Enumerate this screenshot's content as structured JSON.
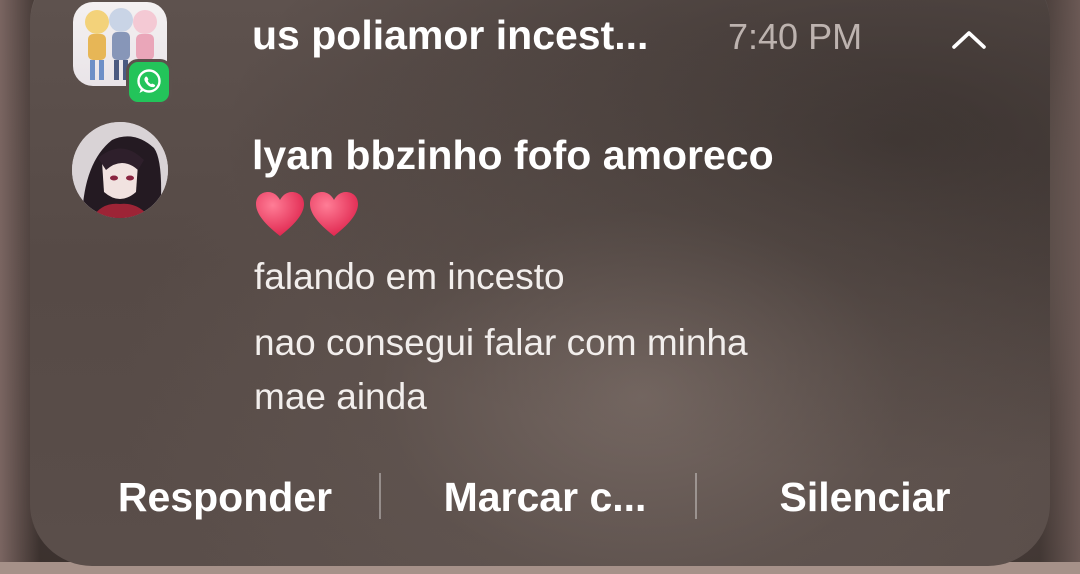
{
  "notification": {
    "app_icon": "whatsapp-icon",
    "group_title": "us poliamor incest...",
    "time": "7:40 PM",
    "collapse_icon": "chevron-up-icon",
    "sender_name": "lyan bbzinho fofo amoreco",
    "messages": [
      {
        "text": "❤️❤️",
        "kind": "emoji"
      },
      {
        "text": "falando em incesto",
        "kind": "text"
      },
      {
        "text": "nao consegui falar com minha",
        "kind": "text"
      },
      {
        "text": "mae ainda",
        "kind": "text"
      }
    ],
    "actions": [
      {
        "label": "Responder"
      },
      {
        "label": "Marcar c..."
      },
      {
        "label": "Silenciar"
      }
    ],
    "colors": {
      "whatsapp_green": "#23c45a",
      "heart_red": "#f2385f",
      "time_gray": "#bdb3af"
    }
  }
}
